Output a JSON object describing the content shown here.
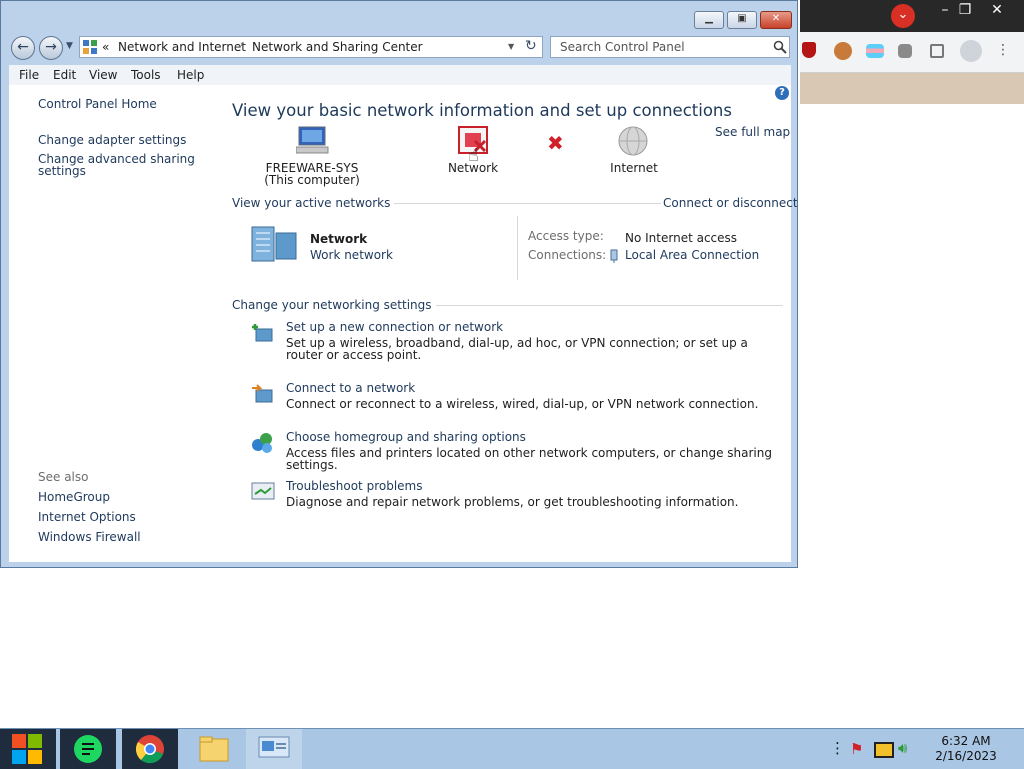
{
  "window": {
    "title_controls": [
      "minimize",
      "maximize",
      "close"
    ]
  },
  "address": {
    "chevron": "«",
    "breadcrumb": [
      "Network and Internet",
      "Network and Sharing Center"
    ],
    "search_placeholder": "Search Control Panel"
  },
  "menubar": [
    "File",
    "Edit",
    "View",
    "Tools",
    "Help"
  ],
  "sidebar": {
    "home": "Control Panel Home",
    "links": [
      "Change adapter settings",
      "Change advanced sharing settings"
    ],
    "see_also_label": "See also",
    "see_also": [
      "HomeGroup",
      "Internet Options",
      "Windows Firewall"
    ]
  },
  "main": {
    "heading": "View your basic network information and set up connections",
    "see_full_map": "See full map",
    "map": {
      "computer_name": "FREEWARE-SYS",
      "computer_sub": "(This computer)",
      "network_label": "Network",
      "internet_label": "Internet"
    },
    "active_networks": {
      "header": "View your active networks",
      "connect_link": "Connect or disconnect",
      "network_name": "Network",
      "network_type": "Work network",
      "access_type_label": "Access type:",
      "access_type_value": "No Internet access",
      "connections_label": "Connections:",
      "connections_value": "Local Area Connection"
    },
    "settings": {
      "header": "Change your networking settings",
      "tasks": [
        {
          "title": "Set up a new connection or network",
          "desc": "Set up a wireless, broadband, dial-up, ad hoc, or VPN connection; or set up a router or access point."
        },
        {
          "title": "Connect to a network",
          "desc": "Connect or reconnect to a wireless, wired, dial-up, or VPN network connection."
        },
        {
          "title": "Choose homegroup and sharing options",
          "desc": "Access files and printers located on other network computers, or change sharing settings."
        },
        {
          "title": "Troubleshoot problems",
          "desc": "Diagnose and repair network problems, or get troubleshooting information."
        }
      ]
    }
  },
  "taskbar": {
    "time": "6:32 AM",
    "date": "2/16/2023"
  },
  "colors": {
    "link": "#1e395b",
    "taskbar": "#a9c6e4",
    "chrome_accent": "#d93025"
  }
}
